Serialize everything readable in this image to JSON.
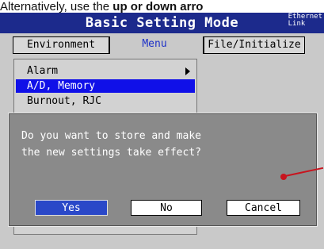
{
  "caption": {
    "text_prefix": "Alternatively, use the ",
    "text_bold": "up or down arro"
  },
  "title_bar": {
    "title": "Basic Setting Mode",
    "badge_line1": "Ethernet",
    "badge_line2": "Link"
  },
  "tabs": [
    {
      "label": "Environment"
    },
    {
      "label": "Menu"
    },
    {
      "label": "File/Initialize"
    }
  ],
  "menu": {
    "items": [
      {
        "label": "Alarm",
        "has_submenu": true
      },
      {
        "label": "A/D, Memory",
        "selected": true
      },
      {
        "label": "Burnout, RJC"
      }
    ]
  },
  "dialog": {
    "message": "Do you want to store and make\nthe new settings take effect?",
    "buttons": {
      "yes": "Yes",
      "no": "No",
      "cancel": "Cancel"
    }
  },
  "colors": {
    "title_bar": "#1c2a8c",
    "selection": "#1010e8",
    "yes_button": "#2a48c8",
    "dialog_bg": "#8a8a8a",
    "screen_bg": "#c9c9c9",
    "marker": "#c8141e"
  }
}
